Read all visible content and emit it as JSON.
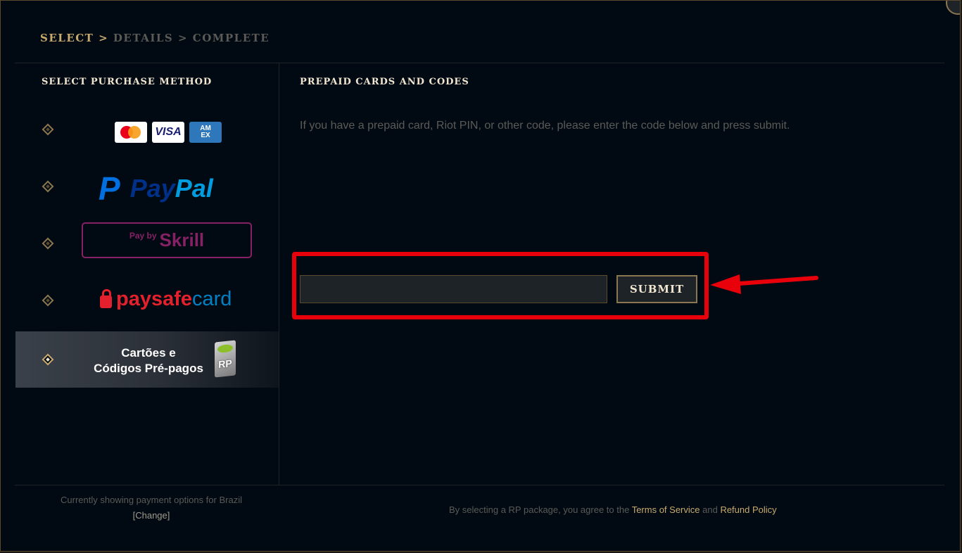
{
  "breadcrumb": {
    "step1": "SELECT",
    "sep1": ">",
    "step2": "DETAILS",
    "sep2": ">",
    "step3": "COMPLETE"
  },
  "sidebar": {
    "title": "SELECT PURCHASE METHOD",
    "methods": {
      "cards": {
        "mastercard": "mastercard-logo",
        "visa": "VISA",
        "amex_line1": "AM",
        "amex_line2": "EX"
      },
      "paypal": {
        "mark": "P",
        "text_a": "Pay",
        "text_b": "Pal"
      },
      "skrill": {
        "prefix": "Pay by",
        "brand": "Skrill"
      },
      "paysafecard": {
        "text_a": "paysafe",
        "text_b": "card"
      },
      "prepaid": {
        "line1": "Cartões e",
        "line2": "Códigos Pré-pagos",
        "badge": "RP",
        "selected": true
      }
    }
  },
  "main": {
    "title": "PREPAID CARDS AND CODES",
    "instruction": "If you have a prepaid card, Riot PIN, or other code, please enter the code below and press submit.",
    "code_input": {
      "value": "",
      "placeholder": ""
    },
    "submit_label": "SUBMIT"
  },
  "footer": {
    "country_text": "Currently showing payment options for  Brazil",
    "change_link": "[Change]",
    "agreement_prefix": "By selecting a RP package, you agree to the ",
    "terms_link": "Terms of Service",
    "agreement_and": " and ",
    "refund_link": "Refund Policy"
  },
  "colors": {
    "background": "#010a13",
    "gold": "#c8aa6e",
    "highlight": "#e8000b",
    "muted_text": "#5b5a56"
  }
}
